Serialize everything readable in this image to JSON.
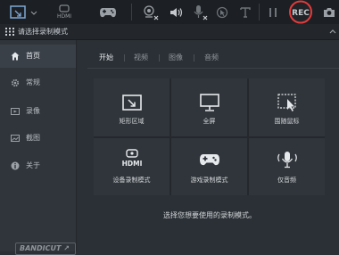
{
  "toolbar": {
    "hdmi_label": "HDMI",
    "rec_label": "REC"
  },
  "title": "请选择录制模式",
  "sidebar": {
    "items": [
      {
        "label": "首页",
        "icon": "home-icon"
      },
      {
        "label": "常规",
        "icon": "gear-icon"
      },
      {
        "label": "录像",
        "icon": "video-icon"
      },
      {
        "label": "截图",
        "icon": "image-icon"
      },
      {
        "label": "关于",
        "icon": "info-icon"
      }
    ],
    "logo": "BANDICUT ↗"
  },
  "tabs": [
    "开始",
    "视频",
    "图像",
    "音频"
  ],
  "modes": [
    {
      "label": "矩形区域",
      "icon": "rectangle-icon"
    },
    {
      "label": "全屏",
      "icon": "monitor-icon"
    },
    {
      "label": "围随鼠标",
      "icon": "cursor-area-icon"
    },
    {
      "label": "设备录制模式",
      "icon": "hdmi-device-icon",
      "badge": "HDMI"
    },
    {
      "label": "游戏录制模式",
      "icon": "gamepad-icon"
    },
    {
      "label": "仅音频",
      "icon": "microphone-icon"
    }
  ],
  "hint": "选择您想要使用的录制模式。",
  "colors": {
    "rec_ring": "#e23b3b",
    "background": "#2b3036"
  }
}
